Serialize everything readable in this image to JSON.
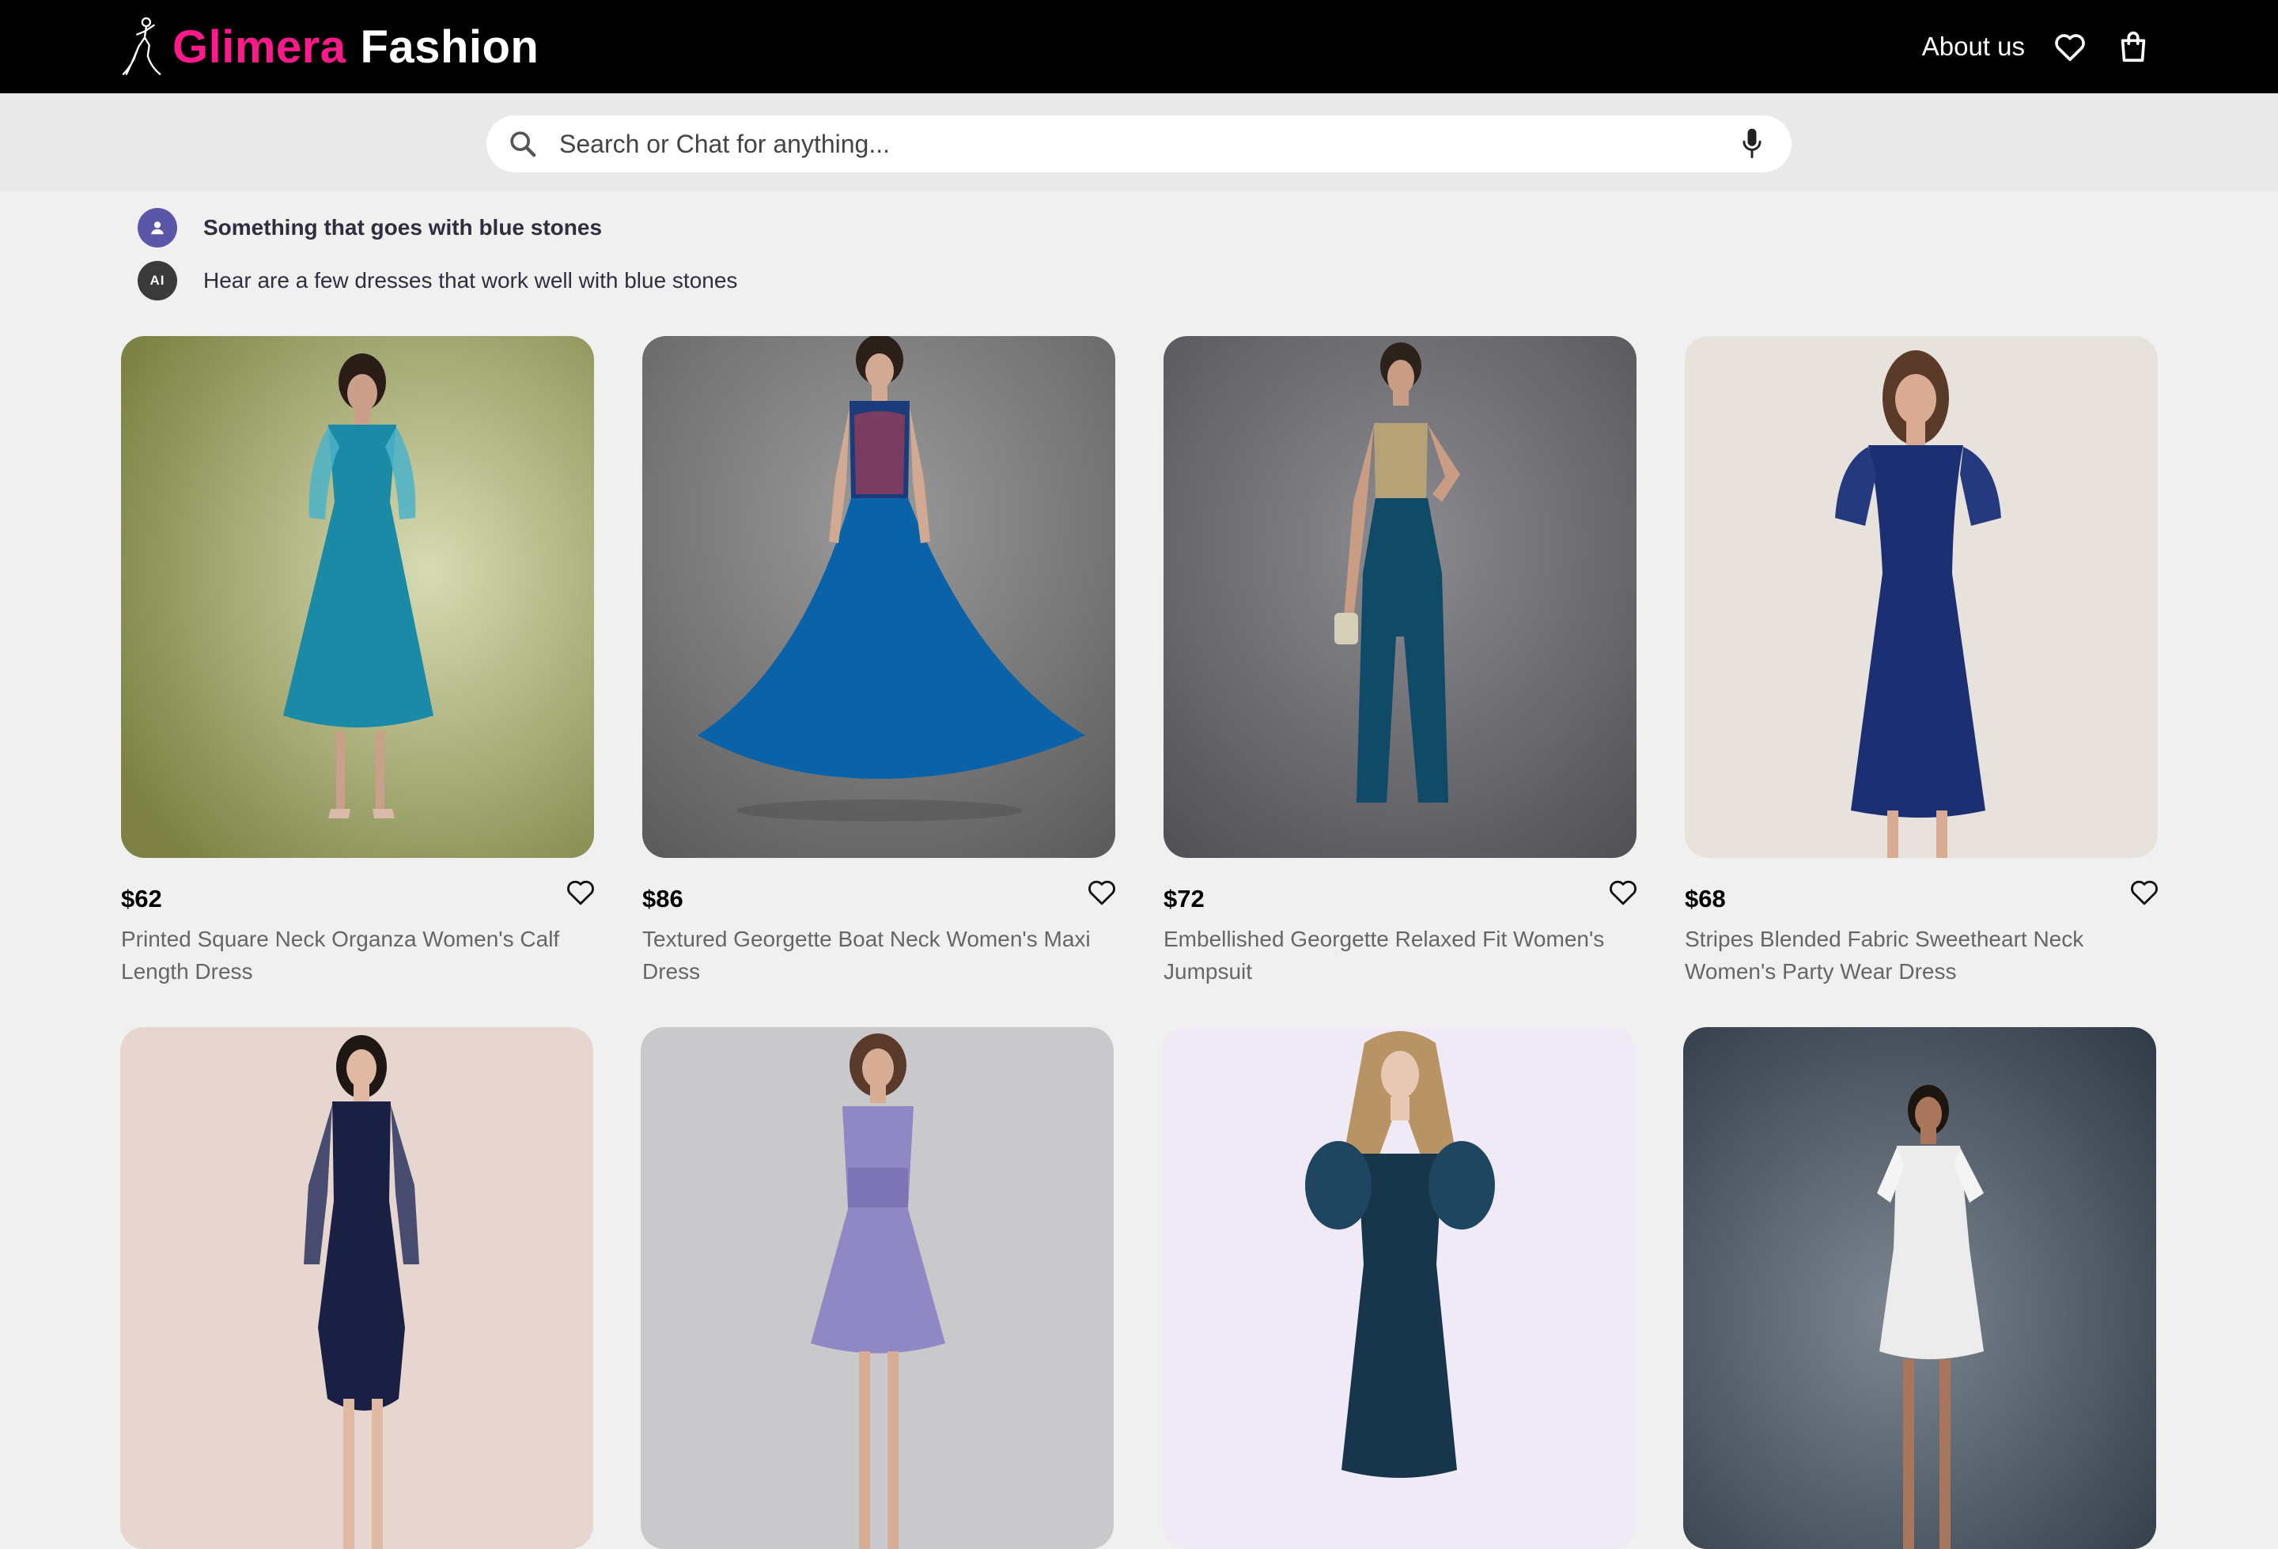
{
  "brand": {
    "name_highlight": "Glimera",
    "name_rest": "Fashion",
    "logo_icon": "dancer-silhouette-icon",
    "accent_color": "#ff1a8c"
  },
  "header": {
    "about_label": "About us",
    "wishlist_icon": "heart-icon",
    "cart_icon": "shopping-bag-icon"
  },
  "search": {
    "placeholder": "Search or Chat for anything...",
    "value": "",
    "search_icon": "search-icon",
    "mic_icon": "microphone-icon"
  },
  "chat": {
    "user_avatar_icon": "user-icon",
    "user_message": "Something that goes with blue stones",
    "ai_avatar_label": "AI",
    "ai_message": "Hear are a few dresses that work well with blue stones"
  },
  "products": [
    {
      "price": "$62",
      "name": "Printed Square Neck Organza Women's Calf Length Dress",
      "dress_color": "#1b8aa6"
    },
    {
      "price": "$86",
      "name": "Textured Georgette Boat Neck Women's Maxi Dress",
      "dress_color": "#0a62a8"
    },
    {
      "price": "$72",
      "name": "Embellished Georgette Relaxed Fit Women's Jumpsuit",
      "dress_color": "#0f4a66"
    },
    {
      "price": "$68",
      "name": "Stripes Blended Fabric Sweetheart Neck Women's Party Wear Dress",
      "dress_color": "#1c2f72"
    },
    {
      "price": "",
      "name": "",
      "dress_color": "#1a2044"
    },
    {
      "price": "",
      "name": "",
      "dress_color": "#8f88c4"
    },
    {
      "price": "",
      "name": "",
      "dress_color": "#17364c"
    },
    {
      "price": "",
      "name": "",
      "dress_color": "#ececec"
    }
  ]
}
